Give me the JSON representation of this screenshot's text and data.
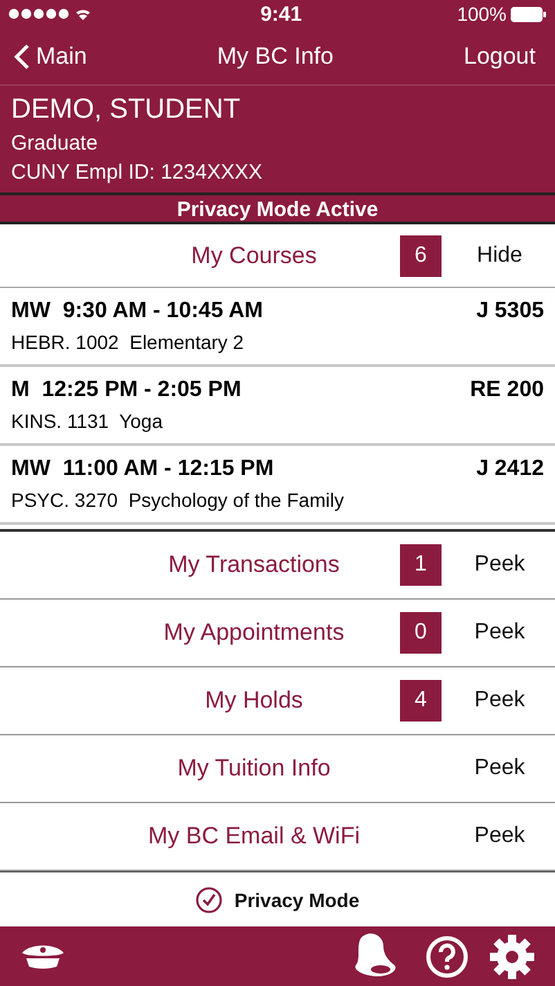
{
  "status_bar": {
    "time": "9:41",
    "battery": "100%"
  },
  "nav": {
    "back": "Main",
    "title": "My BC Info",
    "action": "Logout"
  },
  "profile": {
    "name": "DEMO, STUDENT",
    "level": "Graduate",
    "id": "CUNY Empl ID: 1234XXXX"
  },
  "banner": "Privacy Mode Active",
  "courses": {
    "title": "My Courses",
    "count": "6",
    "toggle": "Hide",
    "rows": [
      {
        "time": "MW  9:30 AM - 10:45 AM",
        "room": "J 5305",
        "course": "HEBR. 1002  Elementary 2"
      },
      {
        "time": "M  12:25 PM - 2:05 PM",
        "room": "RE 200",
        "course": "KINS. 1131  Yoga"
      },
      {
        "time": "MW  11:00 AM - 12:15 PM",
        "room": "J 2412",
        "course": "PSYC. 3270  Psychology of the Family"
      }
    ]
  },
  "sections": [
    {
      "title": "My Transactions",
      "count": "1",
      "toggle": "Peek"
    },
    {
      "title": "My Appointments",
      "count": "0",
      "toggle": "Peek"
    },
    {
      "title": "My Holds",
      "count": "4",
      "toggle": "Peek"
    },
    {
      "title": "My Tuition Info",
      "toggle": "Peek"
    },
    {
      "title": "My BC Email & WiFi",
      "toggle": "Peek"
    }
  ],
  "privacy_mode": {
    "label": "Privacy Mode",
    "checked": true
  }
}
